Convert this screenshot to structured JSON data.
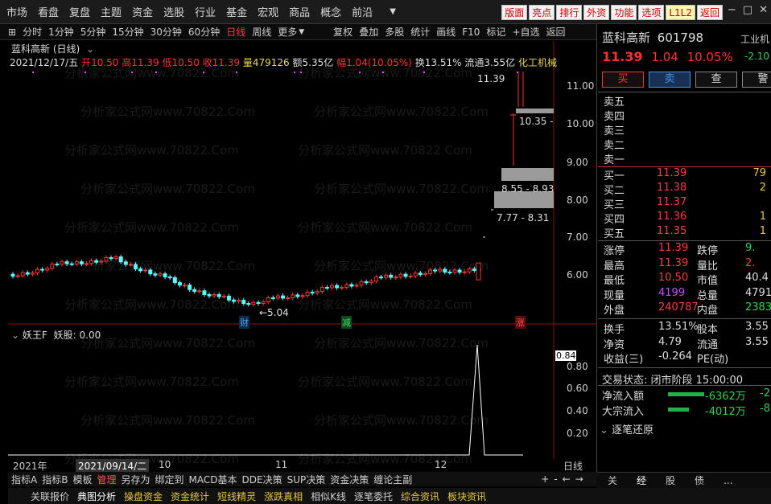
{
  "menu": {
    "items": [
      "市场",
      "看盘",
      "复盘",
      "主题",
      "资金",
      "选股",
      "行业",
      "基金",
      "宏观",
      "商品",
      "概念",
      "前沿"
    ],
    "dropdown_icon": "caret-down-icon",
    "right_buttons": [
      "版面",
      "亮点",
      "排行",
      "外资",
      "功能",
      "选项",
      "L1L2",
      "返回"
    ],
    "window_controls": [
      "−",
      "□",
      "✕"
    ]
  },
  "toolbar": {
    "periods": [
      "分时",
      "1分钟",
      "5分钟",
      "15分钟",
      "30分钟",
      "60分钟",
      "日线",
      "周线",
      "更多"
    ],
    "active_period": "日线",
    "more_label": "更多",
    "tools": [
      "复权",
      "叠加",
      "多股",
      "统计",
      "画线",
      "F10",
      "标记",
      "+自选",
      "返回"
    ]
  },
  "stock": {
    "title": "蓝科高新 (日线)",
    "date": "2021/12/17/五",
    "open_label": "开",
    "open": "10.50",
    "high_label": "高",
    "high": "11.39",
    "low_label": "低",
    "low": "10.50",
    "close_label": "收",
    "close": "11.39",
    "vol_label": "量",
    "vol": "479126",
    "amt_label": "额",
    "amt": "5.35亿",
    "amp_label": "幅",
    "amp": "1.04(10.05%)",
    "turnover_label": "换",
    "turnover": "13.51%",
    "float_label": "流通",
    "float": "3.55亿",
    "sector": "化工机械"
  },
  "chart_data": {
    "type": "candlestick",
    "price_axis": [
      "11.00",
      "10.00",
      "9.00",
      "8.00",
      "7.00",
      "6.00"
    ],
    "annotations": {
      "high_mark": "11.39",
      "low_mark": "←5.04",
      "gap1": "10.35 -",
      "gap2": "8.55 - 8.93",
      "gap3": "7.77 - 8.31"
    },
    "event_tags": [
      "财",
      "减",
      "涨"
    ],
    "indicator": {
      "name": "妖王F",
      "value_label": "妖股",
      "value": "0.00",
      "axis": [
        "0.84",
        "0.80",
        "0.60",
        "0.40",
        "0.20"
      ]
    },
    "timeline": [
      "2021年",
      "2021/09/14/二",
      "10",
      "11",
      "12"
    ],
    "period_label": "日线"
  },
  "watermark": "分析家公式网www.70822.Com",
  "tabs_indicators": [
    "指标A",
    "指标B",
    "模板",
    "管理",
    "另存为",
    "绑定到",
    "MACD基本",
    "DDE决策",
    "SUP决策",
    "资金决策",
    "缠论主副"
  ],
  "tabs_bottom": [
    "关联报价",
    "典图分析",
    "操盘资金",
    "资金统计",
    "短线精灵",
    "涨跌真相",
    "相似K线",
    "逐笔委托",
    "综合资讯",
    "板块资讯"
  ],
  "quote": {
    "name": "蓝科高新",
    "code": "601798",
    "industry": "工业机",
    "price": "11.39",
    "change": "1.04",
    "change_pct": "10.05%",
    "industry_change": "-2.10",
    "buttons": [
      "买",
      "卖",
      "查",
      "警"
    ],
    "asks": [
      {
        "label": "卖五",
        "price": "",
        "vol": ""
      },
      {
        "label": "卖四",
        "price": "",
        "vol": ""
      },
      {
        "label": "卖三",
        "price": "",
        "vol": ""
      },
      {
        "label": "卖二",
        "price": "",
        "vol": ""
      },
      {
        "label": "卖一",
        "price": "",
        "vol": ""
      }
    ],
    "bids": [
      {
        "label": "买一",
        "price": "11.39",
        "vol": "79"
      },
      {
        "label": "买二",
        "price": "11.38",
        "vol": "2"
      },
      {
        "label": "买三",
        "price": "11.37",
        "vol": ""
      },
      {
        "label": "买四",
        "price": "11.36",
        "vol": "1"
      },
      {
        "label": "买五",
        "price": "11.35",
        "vol": "1"
      }
    ],
    "stats": [
      {
        "l1": "涨停",
        "v1": "11.39",
        "l2": "跌停",
        "v2": "9."
      },
      {
        "l1": "最高",
        "v1": "11.39",
        "l2": "量比",
        "v2": "2."
      },
      {
        "l1": "最低",
        "v1": "10.50",
        "l2": "市值",
        "v2": "40.4"
      },
      {
        "l1": "现量",
        "v1": "4199",
        "l2": "总量",
        "v2": "4791"
      },
      {
        "l1": "外盘",
        "v1": "240787",
        "l2": "内盘",
        "v2": "2383"
      }
    ],
    "stats2": [
      {
        "l1": "换手",
        "v1": "13.51%",
        "l2": "股本",
        "v2": "3.55"
      },
      {
        "l1": "净资",
        "v1": "4.79",
        "l2": "流通",
        "v2": "3.55"
      },
      {
        "l1": "收益(三)",
        "v1": "-0.264",
        "l2": "PE(动)",
        "v2": ""
      }
    ],
    "trade_status": "交易状态: 闭市阶段 15:00:00",
    "flows": [
      {
        "label": "净流入额",
        "value": "-6362万",
        "extra": "-2"
      },
      {
        "label": "大宗流入",
        "value": "-4012万",
        "extra": "-8"
      }
    ],
    "detail": "逐笔还原",
    "footer": [
      "关",
      "经",
      "股",
      "债",
      "..."
    ]
  }
}
